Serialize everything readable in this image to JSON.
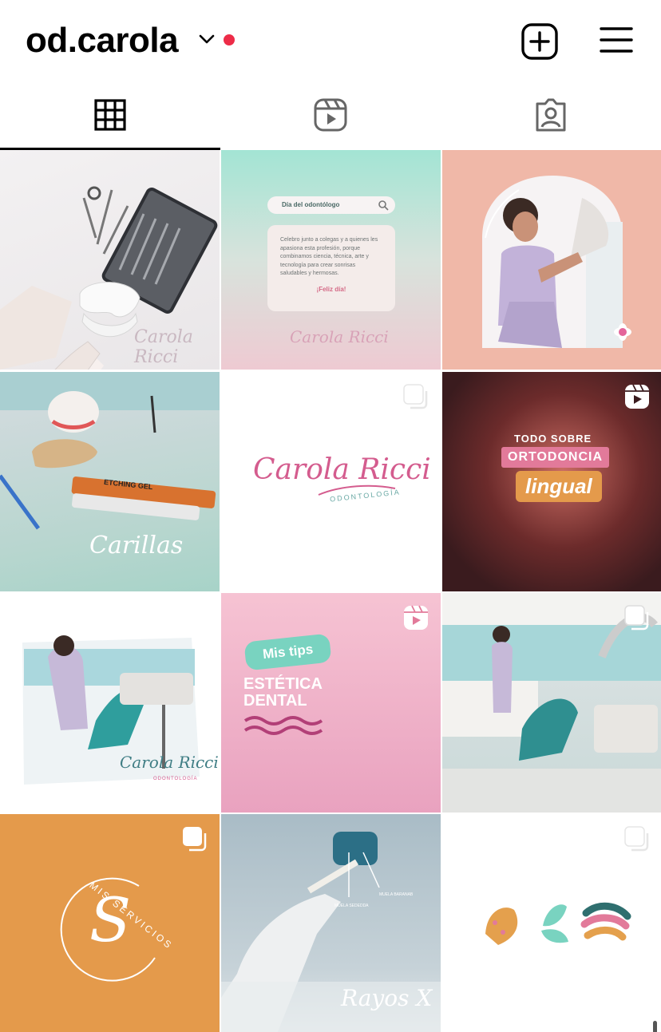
{
  "header": {
    "username": "od.carola",
    "notification_color": "#ed2c48"
  },
  "icons": {
    "dropdown": "chevron-down-icon",
    "new_post": "plus-square-icon",
    "menu": "hamburger-menu-icon"
  },
  "tabs": [
    {
      "name": "posts-grid",
      "icon": "grid-icon",
      "active": true
    },
    {
      "name": "reels",
      "icon": "reels-icon",
      "active": false
    },
    {
      "name": "tagged",
      "icon": "tagged-person-icon",
      "active": false
    }
  ],
  "tiles": {
    "t1": {
      "caption": "Carola Ricci"
    },
    "t2": {
      "search_text": "Día del odontólogo",
      "body": "Celebro junto a colegas y a quienes les apasiona esta profesión, porque combinamos ciencia, técnica, arte y tecnología para crear sonrisas saludables y hermosas.",
      "feliz": "¡Feliz día!",
      "caption": "Carola Ricci"
    },
    "t4": {
      "label": "ETCHING GEL",
      "caption": "Carillas"
    },
    "t5": {
      "brand": "Carola Ricci",
      "sub": "ODONTOLOGÍA",
      "badge": "multi-image-icon"
    },
    "t6": {
      "line1": "TODO SOBRE",
      "line2": "ORTODONCIA",
      "line3": "lingual",
      "badge": "reels-icon"
    },
    "t7": {
      "caption": "Carola Ricci",
      "sub": "ODONTOLOGÍA"
    },
    "t8": {
      "pill": "Mis tips",
      "title1": "ESTÉTICA",
      "title2": "DENTAL",
      "badge": "reels-icon"
    },
    "t9": {
      "badge": "multi-image-icon"
    },
    "t10": {
      "arc_text": "MIS SERVICIOS",
      "letter": "S",
      "badge": "multi-image-icon"
    },
    "t11": {
      "label1": "MUELA SEDEDDA",
      "label2": "MUELA BARANAB",
      "caption": "Rayos X"
    },
    "t12": {
      "badge": "multi-image-icon"
    }
  },
  "colors": {
    "accent_teal": "#79d3c0",
    "accent_pink": "#d45c8e",
    "accent_orange": "#e49a4b"
  }
}
